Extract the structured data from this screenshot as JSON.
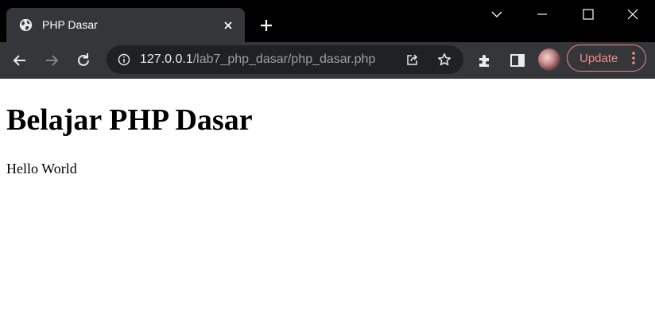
{
  "browser": {
    "tab": {
      "title": "PHP Dasar",
      "icon": "globe-icon"
    },
    "address_bar": {
      "host": "127.0.0.1",
      "path": "/lab7_php_dasar/php_dasar.php"
    },
    "update_button": {
      "label": "Update"
    },
    "colors": {
      "frame": "#000000",
      "toolbar": "#35363a",
      "omnibox": "#202124",
      "update_accent": "#f28b82"
    }
  },
  "page": {
    "heading": "Belajar PHP Dasar",
    "paragraph": "Hello World"
  }
}
